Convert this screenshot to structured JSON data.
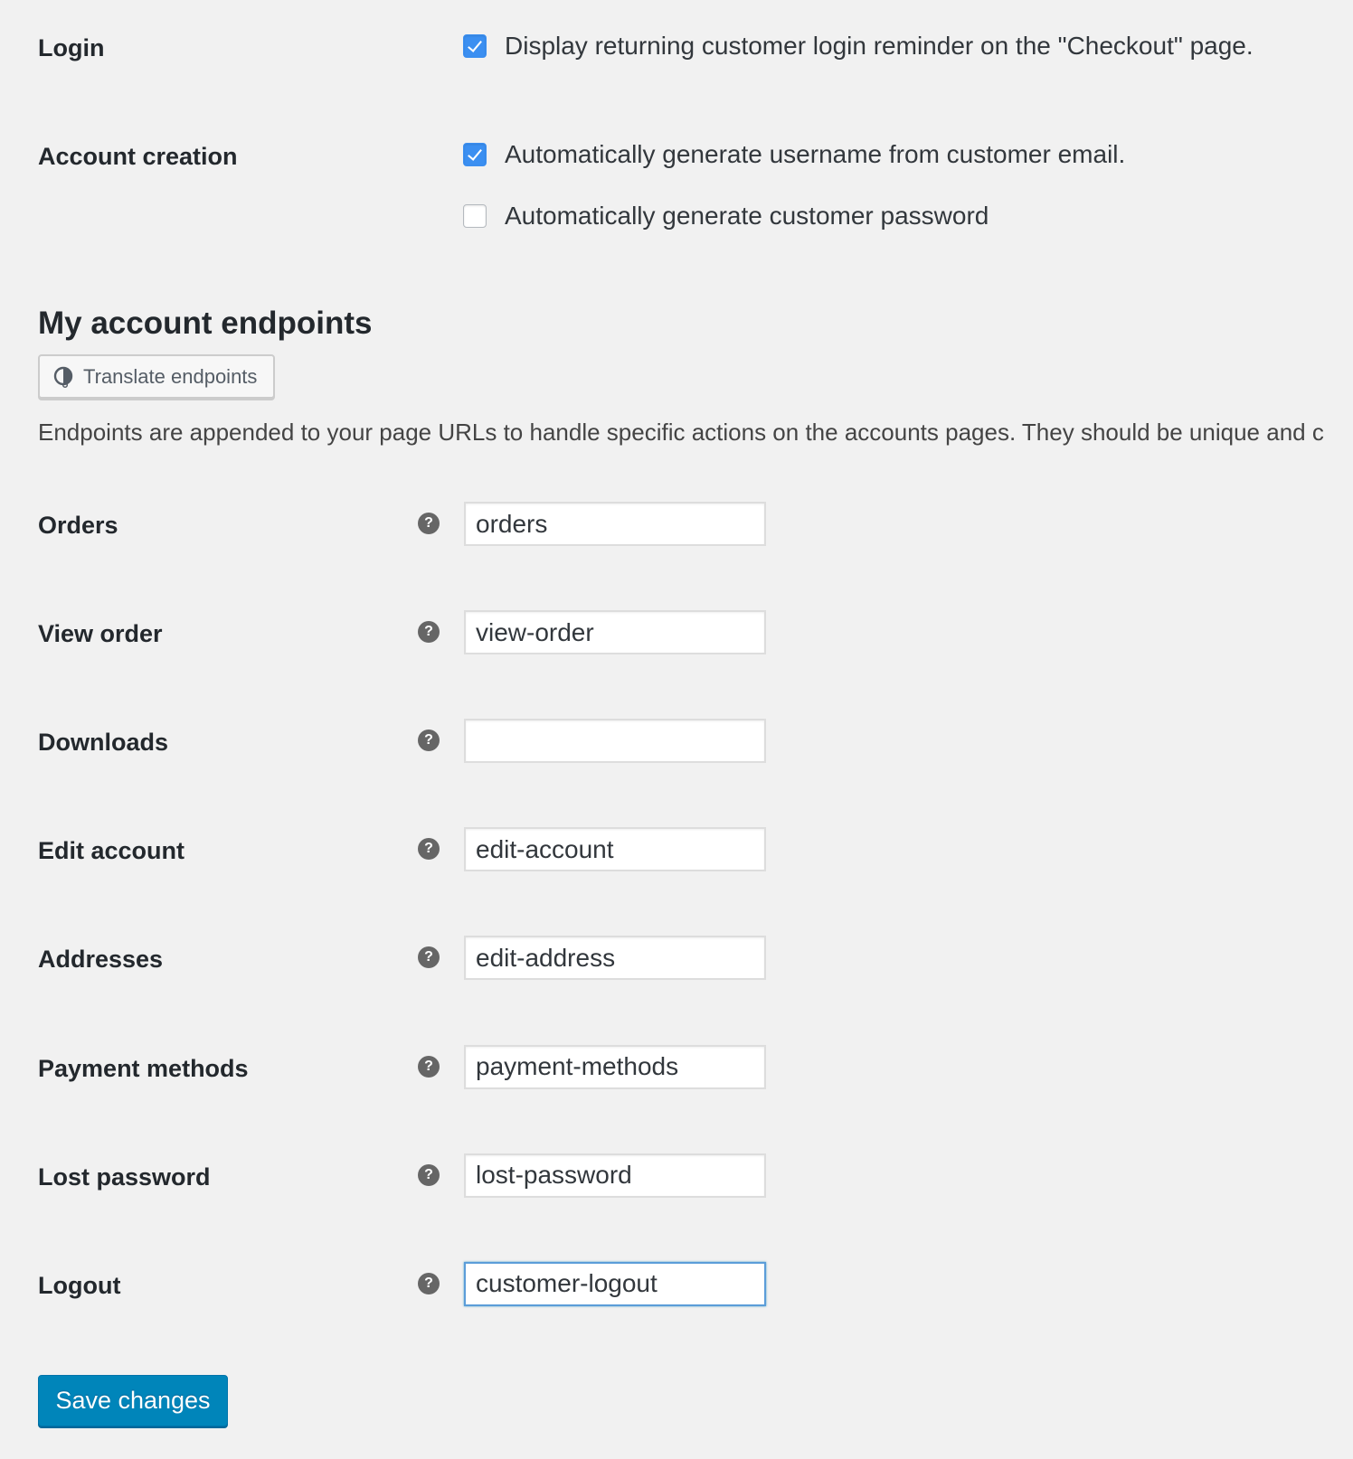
{
  "login": {
    "label": "Login",
    "options": [
      {
        "label": "Display returning customer login reminder on the \"Checkout\" page.",
        "checked": true
      }
    ]
  },
  "account_creation": {
    "label": "Account creation",
    "options": [
      {
        "label": "Automatically generate username from customer email.",
        "checked": true
      },
      {
        "label": "Automatically generate customer password",
        "checked": false
      }
    ]
  },
  "endpoints": {
    "heading": "My account endpoints",
    "translate_button": "Translate endpoints",
    "description": "Endpoints are appended to your page URLs to handle specific actions on the accounts pages. They should be unique and c",
    "help_glyph": "?",
    "fields": [
      {
        "label": "Orders",
        "value": "orders"
      },
      {
        "label": "View order",
        "value": "view-order"
      },
      {
        "label": "Downloads",
        "value": ""
      },
      {
        "label": "Edit account",
        "value": "edit-account"
      },
      {
        "label": "Addresses",
        "value": "edit-address"
      },
      {
        "label": "Payment methods",
        "value": "payment-methods"
      },
      {
        "label": "Lost password",
        "value": "lost-password"
      },
      {
        "label": "Logout",
        "value": "customer-logout",
        "focused": true
      }
    ]
  },
  "save_button": "Save changes",
  "colors": {
    "checkbox_checked": "#3b8ff1",
    "primary_button": "#0085ba",
    "focus_border": "#5b9dd9"
  }
}
